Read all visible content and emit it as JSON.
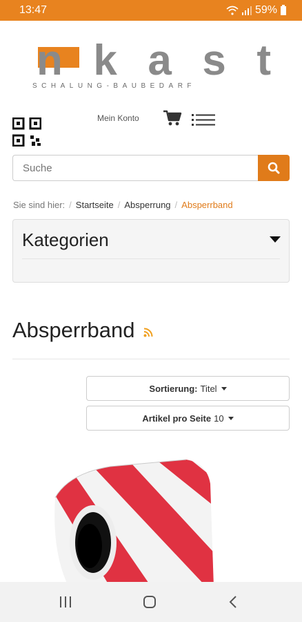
{
  "statusbar": {
    "time": "13:47",
    "battery": "59%"
  },
  "header": {
    "logo_text": "nkast",
    "logo_tagline": "SCHALUNG-BAUBEDARF",
    "account_label": "Mein Konto"
  },
  "search": {
    "placeholder": "Suche"
  },
  "breadcrumb": {
    "prefix": "Sie sind hier:",
    "items": [
      "Startseite",
      "Absperrung",
      "Absperrband"
    ]
  },
  "categories": {
    "title": "Kategorien"
  },
  "page": {
    "title": "Absperrband"
  },
  "sorting": {
    "sort_label": "Sortierung:",
    "sort_value": "Titel",
    "per_page_label": "Artikel pro Seite",
    "per_page_value": "10"
  },
  "colors": {
    "accent": "#e07b1a",
    "statusbar": "#e8831f"
  }
}
